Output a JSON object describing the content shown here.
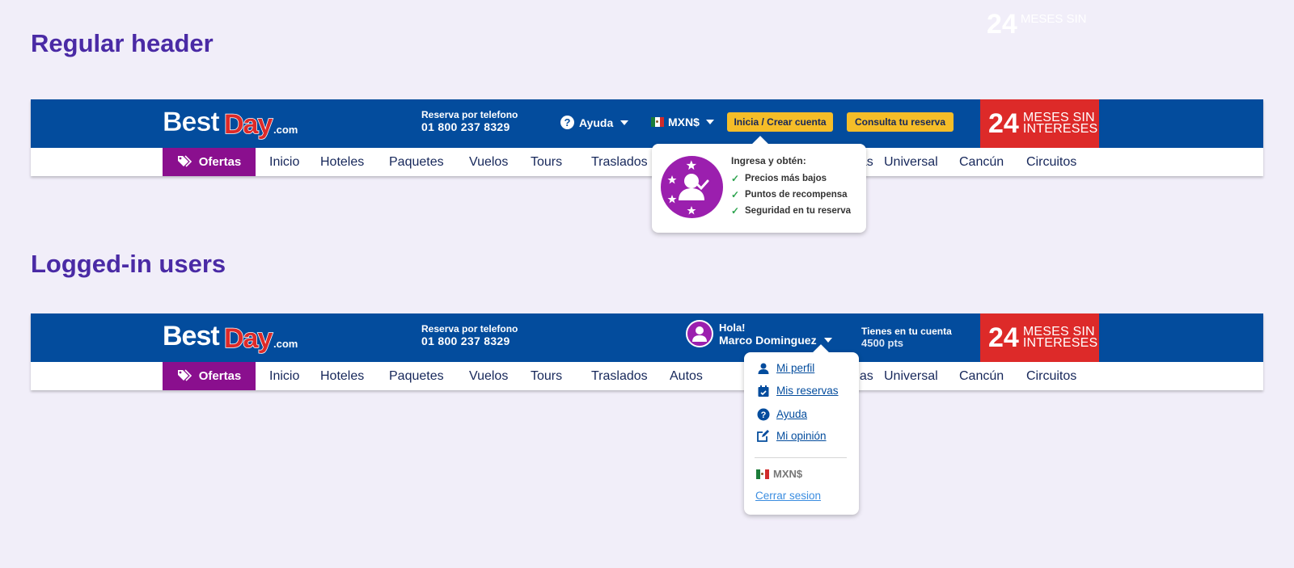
{
  "sections": {
    "regular_title": "Regular header",
    "logged_title": "Logged-in users"
  },
  "ghost_promo": {
    "number": "24",
    "text": "MESES SIN"
  },
  "header": {
    "logo": "BestDay.com",
    "phone_label": "Reserva por telefono",
    "phone_number": "01 800 237 8329",
    "help_label": "Ayuda",
    "currency": "MXN$",
    "login_button": "Inicia / Crear cuenta",
    "reservation_button": "Consulta tu reserva",
    "promo_number": "24",
    "promo_line1": "MESES SIN",
    "promo_line2": "INTERESES"
  },
  "nav": {
    "ofertas": "Ofertas",
    "items": [
      "Inicio",
      "Hoteles",
      "Paquetes",
      "Vuelos",
      "Tours",
      "Traslados",
      "Autos",
      "Vegas",
      "Universal",
      "Cancún",
      "Circuitos"
    ],
    "items_visible_regular": {
      "vegas_fragment": "gas"
    },
    "items_visible_logged": {
      "vegas_fragment": "gas"
    }
  },
  "login_popover": {
    "heading": "Ingresa y obtén:",
    "benefits": [
      "Precios más bajos",
      "Puntos de recompensa",
      "Seguridad en tu reserva"
    ]
  },
  "user": {
    "greeting": "Hola!",
    "name": "Marco Dominguez",
    "points_label": "Tienes en tu cuenta",
    "points_value": "4500 pts"
  },
  "user_menu": {
    "items": [
      "Mi perfil",
      "Mis reservas",
      "Ayuda",
      "Mi opinión"
    ],
    "currency": "MXN$",
    "logout": "Cerrar sesion"
  },
  "colors": {
    "brand_blue": "#034c9d",
    "promo_red": "#dd2a29",
    "accent_yellow": "#f5bd28",
    "ofertas_purple": "#8a0f8e",
    "title_purple": "#4a2aa5"
  }
}
